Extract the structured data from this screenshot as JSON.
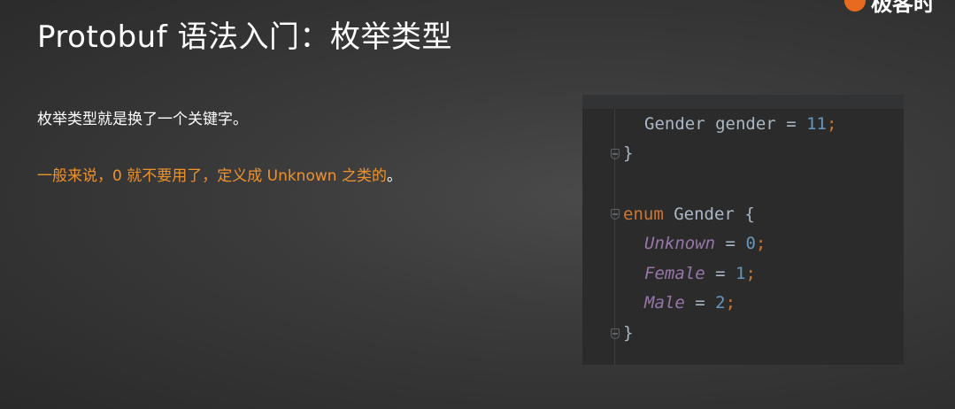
{
  "slide": {
    "title": "Protobuf 语法入门：枚举类型",
    "logo_text": "极客时",
    "paragraph1": "枚举类型就是换了一个关键字。",
    "paragraph2_highlight": "一般来说，0 就不要用了，定义成 Unknown 之类的",
    "paragraph2_end": "。"
  },
  "code": {
    "line1_type": "Gender",
    "line1_field": "gender",
    "line1_eq": "=",
    "line1_num": "11",
    "semicolon": ";",
    "close_brace": "}",
    "enum_keyword": "enum",
    "enum_name": "Gender",
    "open_brace": "{",
    "values": [
      {
        "name": "Unknown",
        "eq": "=",
        "num": "0"
      },
      {
        "name": "Female",
        "eq": "=",
        "num": "1"
      },
      {
        "name": "Male",
        "eq": "=",
        "num": "2"
      }
    ]
  },
  "colors": {
    "accent_orange": "#f0922a",
    "code_bg": "#2b2b2b",
    "keyword": "#cc7832",
    "enum_constant": "#9876aa",
    "number": "#6897bb",
    "plain_text": "#a9b7c6"
  }
}
